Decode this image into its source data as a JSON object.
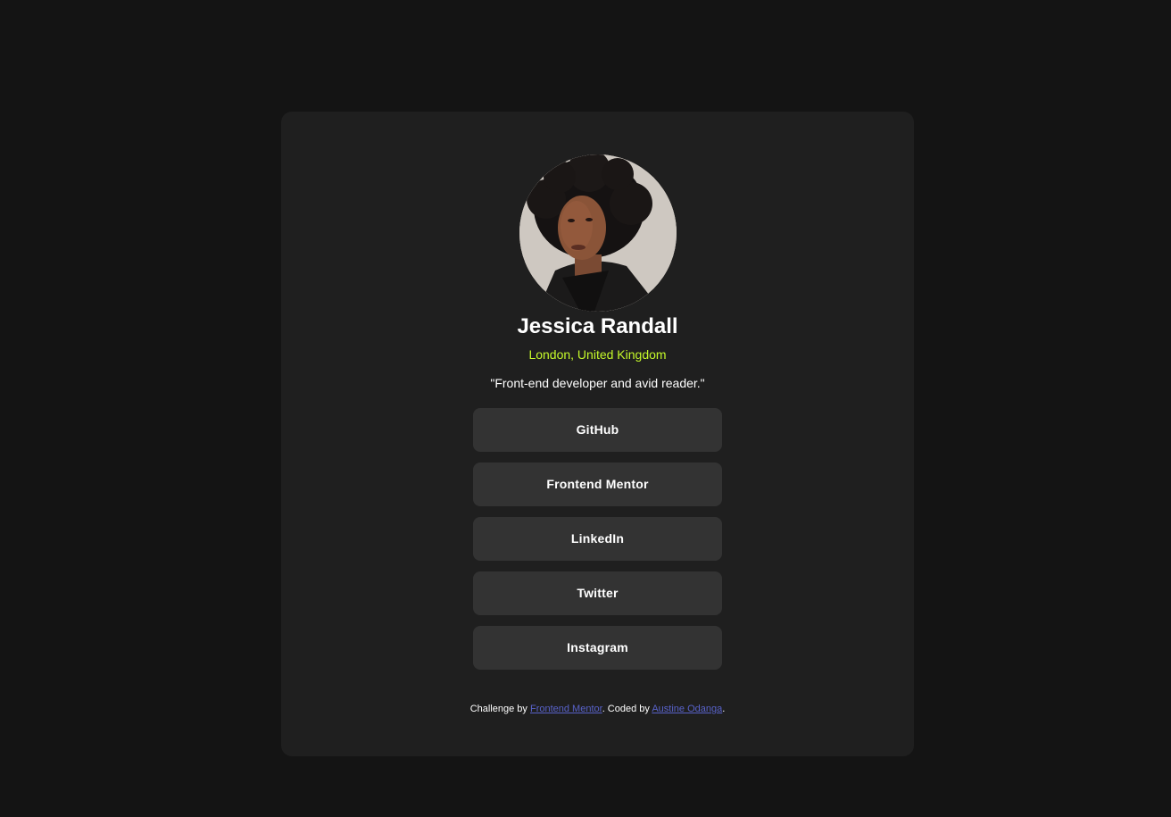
{
  "profile": {
    "name": "Jessica Randall",
    "location": "London, United Kingdom",
    "bio": "\"Front-end developer and avid reader.\""
  },
  "links": [
    {
      "label": "GitHub"
    },
    {
      "label": "Frontend Mentor"
    },
    {
      "label": "LinkedIn"
    },
    {
      "label": "Twitter"
    },
    {
      "label": "Instagram"
    }
  ],
  "attribution": {
    "prefix": "Challenge by ",
    "challenge_link": "Frontend Mentor",
    "middle": ". Coded by ",
    "author_link": "Austine Odanga",
    "suffix": "."
  },
  "colors": {
    "page_background": "#141414",
    "card_background": "#1f1f1f",
    "button_background": "#333333",
    "accent_green": "#c4f82a",
    "link_blue": "#5862c9"
  },
  "icons": {
    "avatar": "avatar-photo"
  }
}
